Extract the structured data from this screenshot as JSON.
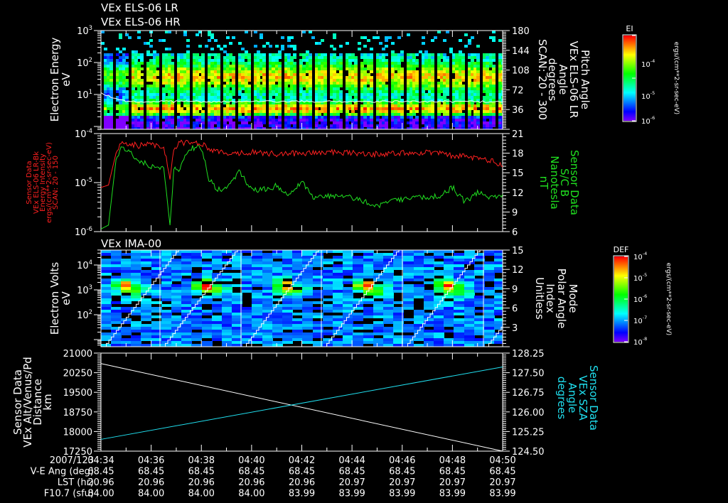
{
  "titles": {
    "panel1_line1": "VEx ELS-06 LR",
    "panel1_line2": "VEx ELS-06 HR",
    "panel3": "VEx IMA-00"
  },
  "panel1": {
    "left_label": [
      "Electron Energy",
      "eV"
    ],
    "right_label": [
      "Pitch Angle",
      "VEx ELS-06 LR",
      "Angle",
      "degrees",
      "SCAN: 20 - 300"
    ],
    "left_ticks": [
      {
        "base": "10",
        "exp": "3"
      },
      {
        "base": "10",
        "exp": "2"
      },
      {
        "base": "10",
        "exp": "1"
      }
    ],
    "right_ticks": [
      "180",
      "144",
      "108",
      "72",
      "36"
    ]
  },
  "panel2": {
    "left_label": [
      "Sensor Data",
      "VEx ELS-06 LR-Bk",
      "Energy Intensity",
      "ergs/(cm**2-sr-sec-eV)",
      "SCAN: 20 - 150"
    ],
    "right_label": [
      "Sensor Data",
      "S/C B",
      "Nanotesla",
      "nT"
    ],
    "left_ticks": [
      {
        "base": "10",
        "exp": "-4"
      },
      {
        "base": "10",
        "exp": "-5"
      },
      {
        "base": "10",
        "exp": "-6"
      }
    ],
    "right_ticks": [
      "21",
      "18",
      "15",
      "12",
      "9",
      "6"
    ]
  },
  "panel3": {
    "left_label": [
      "Electron Volts",
      "eV"
    ],
    "right_label": [
      "Mode",
      "Polar Angle",
      "Index",
      "Unitless"
    ],
    "left_ticks": [
      {
        "base": "10",
        "exp": "4"
      },
      {
        "base": "10",
        "exp": "3"
      },
      {
        "base": "10",
        "exp": "2"
      }
    ],
    "right_ticks": [
      "15",
      "12",
      "9",
      "6",
      "3"
    ]
  },
  "panel4": {
    "left_label": [
      "Sensor Data",
      "VEx Alt/Venus/Pd",
      "Distance",
      "km"
    ],
    "right_label": [
      "Sensor Data",
      "VEx SZA",
      "Angle",
      "degrees"
    ],
    "left_ticks": [
      "21000",
      "20250",
      "19500",
      "18750",
      "18000",
      "17250"
    ],
    "right_ticks": [
      "128.25",
      "127.50",
      "126.75",
      "126.00",
      "125.25",
      "124.50"
    ]
  },
  "colorbars": {
    "ei": {
      "title": "EI",
      "ticks": [
        {
          "base": "10",
          "exp": "-4"
        },
        {
          "base": "10",
          "exp": "-5"
        },
        {
          "base": "10",
          "exp": "-6"
        }
      ],
      "units": "ergs/(cm**2-sr-sec-eV)"
    },
    "def": {
      "title": "DEF",
      "ticks": [
        {
          "base": "10",
          "exp": "-4"
        },
        {
          "base": "10",
          "exp": "-5"
        },
        {
          "base": "10",
          "exp": "-6"
        },
        {
          "base": "10",
          "exp": "-7"
        },
        {
          "base": "10",
          "exp": "-8"
        }
      ],
      "units": "ergs/(cm**2-sr-sec-eV)"
    }
  },
  "table": {
    "row_labels": [
      "2007/123",
      "V-E Ang (deg)",
      "LST (hr)",
      "F10.7 (sfu)"
    ],
    "columns": [
      [
        "04:34",
        "68.45",
        "20.96",
        "84.00"
      ],
      [
        "04:36",
        "68.45",
        "20.96",
        "84.00"
      ],
      [
        "04:38",
        "68.45",
        "20.96",
        "84.00"
      ],
      [
        "04:40",
        "68.45",
        "20.96",
        "84.00"
      ],
      [
        "04:42",
        "68.45",
        "20.96",
        "83.99"
      ],
      [
        "04:44",
        "68.45",
        "20.97",
        "83.99"
      ],
      [
        "04:46",
        "68.45",
        "20.97",
        "83.99"
      ],
      [
        "04:48",
        "68.45",
        "20.97",
        "83.99"
      ],
      [
        "04:50",
        "68.45",
        "20.97",
        "83.99"
      ]
    ]
  },
  "colors": {
    "white": "#ffffff",
    "red": "#ff2020",
    "green": "#20e020",
    "cyan": "#20e0f0"
  },
  "chart_data": [
    {
      "type": "heatmap",
      "title": "VEx ELS-06 LR / HR",
      "ylabel": "Electron Energy (eV)",
      "ylim_log10": [
        0,
        3
      ],
      "xlim_min": [
        0,
        16
      ],
      "overlay": "pitch angle scan 20-300 (deg), approx ~6 eV white trace"
    },
    {
      "type": "line",
      "ylabel_left": "Energy Intensity ergs/(cm**2-sr-sec-eV)",
      "ylabel_right": "S/C B (nT)",
      "ylim_left_log10": [
        -6,
        -4
      ],
      "ylim_right": [
        6,
        21
      ],
      "series": [
        {
          "name": "VEx ELS-06 LR-Bk",
          "color": "red",
          "t_min": [
            0,
            0.3,
            0.6,
            0.8,
            1.0,
            1.5,
            2.0,
            2.5,
            2.75,
            2.9,
            3.1,
            3.5,
            4.0,
            4.5,
            5,
            6,
            7,
            8,
            9,
            10,
            11,
            12,
            13,
            14,
            15,
            15.5,
            16
          ],
          "log10_value": [
            -5.1,
            -5.05,
            -4.4,
            -4.2,
            -4.2,
            -4.25,
            -4.22,
            -4.25,
            -4.9,
            -4.3,
            -4.2,
            -4.17,
            -4.2,
            -4.35,
            -4.4,
            -4.38,
            -4.42,
            -4.4,
            -4.38,
            -4.4,
            -4.42,
            -4.4,
            -4.38,
            -4.45,
            -4.5,
            -4.55,
            -4.65
          ]
        },
        {
          "name": "S/C B",
          "color": "green",
          "t_min": [
            0,
            0.3,
            0.6,
            0.8,
            1.0,
            1.5,
            2.0,
            2.5,
            2.75,
            2.9,
            3.1,
            3.5,
            4.0,
            4.3,
            4.6,
            5,
            5.5,
            6,
            6.5,
            7,
            7.5,
            8,
            8.5,
            9,
            10,
            11,
            12,
            13,
            13.5,
            14,
            14.5,
            15,
            15.5,
            16
          ],
          "value": [
            6.4,
            7.0,
            17.0,
            18.8,
            18.5,
            17.0,
            16.0,
            15.8,
            6.6,
            15.5,
            15.5,
            18.8,
            18.8,
            14.0,
            12.6,
            12.5,
            15.3,
            12.3,
            12.5,
            13.0,
            11.5,
            13.5,
            11.0,
            11.5,
            11.2,
            10.0,
            11.0,
            11.2,
            11.5,
            12.8,
            10.5,
            12.0,
            11.3,
            11.6
          ]
        }
      ]
    },
    {
      "type": "heatmap",
      "title": "VEx IMA-00",
      "ylabel": "Electron Volts (eV)",
      "ylim_log10": [
        1,
        4.6
      ],
      "overlay": "Mode Polar Angle Index 0-15 staircase, period ~3.2 min",
      "peaks_eV_approx": 1500
    },
    {
      "type": "line",
      "ylabel_left": "VEx Alt/Venus/Pd Distance (km)",
      "ylabel_right": "VEx SZA Angle (degrees)",
      "ylim_left": [
        17250,
        21000
      ],
      "ylim_right": [
        124.5,
        128.25
      ],
      "series": [
        {
          "name": "Distance",
          "color": "white",
          "t_min": [
            0,
            16
          ],
          "value": [
            20600,
            17250
          ]
        },
        {
          "name": "SZA",
          "color": "cyan",
          "t_min": [
            0,
            16
          ],
          "value": [
            124.95,
            127.72
          ]
        }
      ]
    }
  ]
}
